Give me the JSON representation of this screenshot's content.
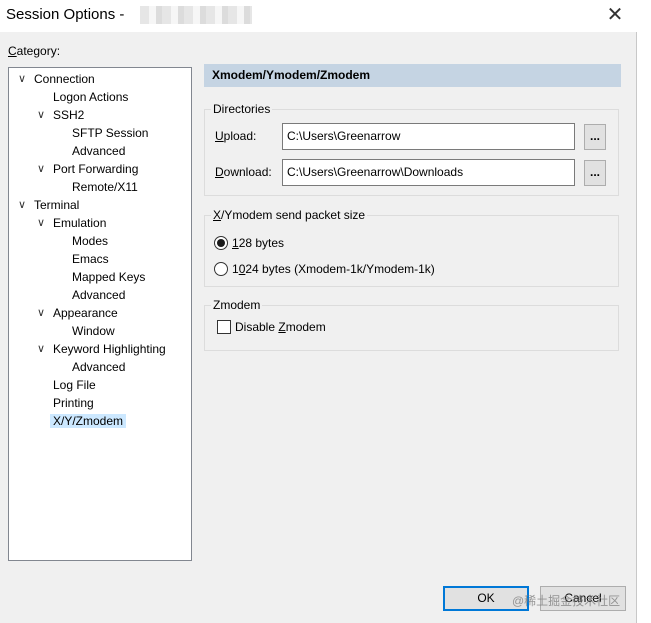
{
  "window": {
    "title": "Session Options -",
    "close_glyph": "✕"
  },
  "category": {
    "label_pre": "",
    "label_ul": "C",
    "label_post": "ategory:",
    "items": [
      {
        "label": "Connection",
        "expanded": true
      },
      {
        "label": "Logon Actions"
      },
      {
        "label": "SSH2",
        "expanded": true
      },
      {
        "label": "SFTP Session"
      },
      {
        "label": "Advanced"
      },
      {
        "label": "Port Forwarding",
        "expanded": true
      },
      {
        "label": "Remote/X11"
      },
      {
        "label": "Terminal",
        "expanded": true
      },
      {
        "label": "Emulation",
        "expanded": true
      },
      {
        "label": "Modes"
      },
      {
        "label": "Emacs"
      },
      {
        "label": "Mapped Keys"
      },
      {
        "label": "Advanced"
      },
      {
        "label": "Appearance",
        "expanded": true
      },
      {
        "label": "Window"
      },
      {
        "label": "Keyword Highlighting",
        "expanded": true
      },
      {
        "label": "Advanced"
      },
      {
        "label": "Log File"
      },
      {
        "label": "Printing"
      },
      {
        "label": "X/Y/Zmodem",
        "selected": true
      }
    ]
  },
  "panel": {
    "header": "Xmodem/Ymodem/Zmodem",
    "directories": {
      "title": "Directories",
      "upload_label_ul": "U",
      "upload_label_post": "pload:",
      "upload_value": "C:\\Users\\Greenarrow",
      "download_label_ul": "D",
      "download_label_post": "ownload:",
      "download_value": "C:\\Users\\Greenarrow\\Downloads",
      "browse_label": "..."
    },
    "packet_size": {
      "title_ul": "X",
      "title_post": "/Ymodem send packet size",
      "opt128_ul": "1",
      "opt128_post": "28 bytes",
      "opt1024_pre": "1",
      "opt1024_ul": "0",
      "opt1024_post": "24 bytes  (Xmodem-1k/Ymodem-1k)",
      "selected": "128"
    },
    "zmodem": {
      "title": "Zmodem",
      "disable_pre": "Disable ",
      "disable_ul": "Z",
      "disable_post": "modem",
      "disabled_checked": false
    }
  },
  "buttons": {
    "ok": "OK",
    "cancel": "Cancel"
  },
  "watermark": "@稀土掘金技术社区"
}
